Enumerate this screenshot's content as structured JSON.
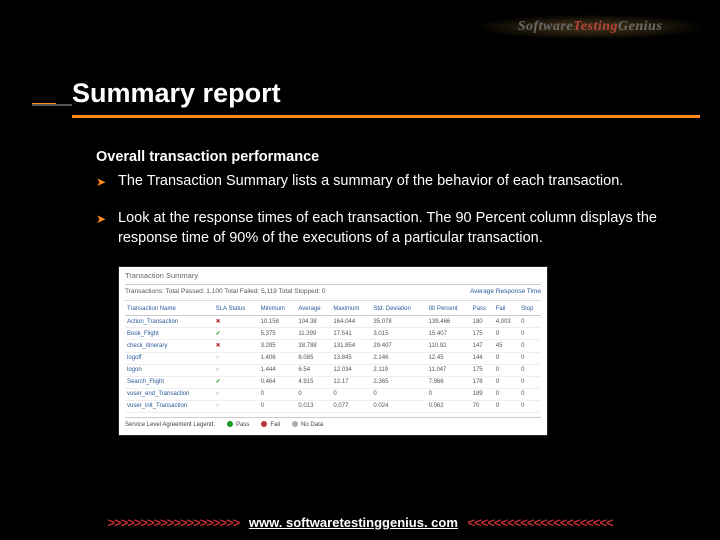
{
  "logo": {
    "part1": "Software ",
    "part2": "Testing ",
    "part3": "Genius"
  },
  "title": "Summary report",
  "subhead": "Overall transaction performance",
  "bullets": [
    "The Transaction Summary lists a summary of the behavior of each transaction.",
    "Look at the response times of each transaction. The 90 Percent column displays the response time of 90% of the executions of a particular transaction."
  ],
  "screenshot": {
    "title": "Transaction Summary",
    "subtitle": "Transactions: Total Passed: 1,100 Total Failed: 5,119 Total Stopped: 0",
    "avg_label": "Average Response Time",
    "headers": [
      "Transaction Name",
      "SLA Status",
      "Minimum",
      "Average",
      "Maximum",
      "Std. Deviation",
      "90 Percent",
      "Pass",
      "Fail",
      "Stop"
    ],
    "rows": [
      [
        "Action_Transaction",
        "fail",
        "10.158",
        "104.38",
        "164.044",
        "35.078",
        "139.466",
        "180",
        "4,003",
        "0"
      ],
      [
        "Book_Flight",
        "pass",
        "5.375",
        "11.399",
        "17.541",
        "3.015",
        "15.407",
        "175",
        "0",
        "0"
      ],
      [
        "check_itinerary",
        "fail",
        "3.295",
        "38.788",
        "131.854",
        "29.407",
        "110.92",
        "147",
        "45",
        "0"
      ],
      [
        "logoff",
        "none",
        "1.406",
        "8.085",
        "13.845",
        "2.146",
        "12.45",
        "144",
        "0",
        "0"
      ],
      [
        "logon",
        "none",
        "1.444",
        "6.54",
        "12.034",
        "2.119",
        "11.047",
        "175",
        "0",
        "0"
      ],
      [
        "Search_Flight",
        "pass",
        "0.464",
        "4.915",
        "12.17",
        "2.365",
        "7.966",
        "178",
        "0",
        "0"
      ],
      [
        "vuser_end_Transaction",
        "none",
        "0",
        "0",
        "0",
        "0",
        "0",
        "189",
        "0",
        "0"
      ],
      [
        "vuser_init_Transaction",
        "none",
        "0",
        "0.013",
        "0.077",
        "0.024",
        "0.062",
        "70",
        "0",
        "0"
      ]
    ],
    "legend_label": "Service Level Agreement Legend:",
    "legend": [
      "Pass",
      "Fail",
      "No Data"
    ]
  },
  "footer": {
    "left": ">>>>>>>>>>>>>>>>>>>>",
    "url": "www. softwaretestinggenius. com",
    "right": "<<<<<<<<<<<<<<<<<<<<<<"
  }
}
